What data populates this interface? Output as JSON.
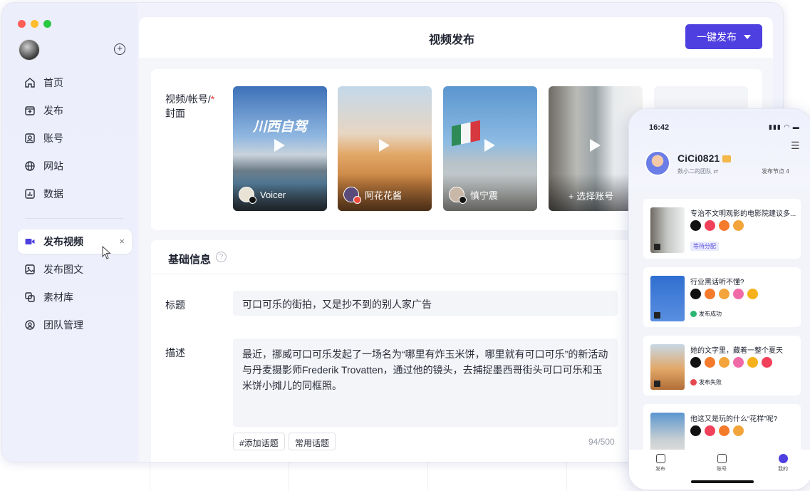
{
  "sidebar": {
    "items": [
      {
        "label": "首页",
        "icon": "home-icon"
      },
      {
        "label": "发布",
        "icon": "publish-icon"
      },
      {
        "label": "账号",
        "icon": "account-icon"
      },
      {
        "label": "网站",
        "icon": "globe-icon"
      },
      {
        "label": "数据",
        "icon": "chart-icon"
      }
    ],
    "open_items": [
      {
        "label": "发布视频",
        "icon": "video-icon",
        "active": true
      },
      {
        "label": "发布图文",
        "icon": "image-icon"
      },
      {
        "label": "素材库",
        "icon": "library-icon"
      },
      {
        "label": "团队管理",
        "icon": "team-icon"
      }
    ],
    "close_glyph": "×"
  },
  "header": {
    "title": "视频发布",
    "publish_label": "一键发布"
  },
  "cover": {
    "label": "视频/帐号/",
    "label2": "封面",
    "required_mark": "*",
    "videos": [
      {
        "account": "Voicer",
        "overlay_text": "川西自驾"
      },
      {
        "account": "阿花花酱"
      },
      {
        "account": "慎宁震"
      },
      {
        "account": "+ 选择账号"
      }
    ]
  },
  "basic": {
    "section_title": "基础信息",
    "help_glyph": "?",
    "title_label": "标题",
    "title_value": "可口可乐的街拍，又是抄不到的别人家广告",
    "desc_label": "描述",
    "desc_value": "最近，挪威可口可乐发起了一场名为“哪里有炸玉米饼，哪里就有可口可乐”的新活动与丹麦摄影师Frederik Trovatten，通过他的镜头，去捕捉墨西哥街头可口可乐和玉米饼小摊儿的同框照。",
    "tags": [
      "#添加话题",
      "常用话题"
    ],
    "counter": "94/500"
  },
  "phone": {
    "time": "16:42",
    "status_icons": "▮▮▮ ◠ ▬",
    "menu_glyph": "☰",
    "user_name": "CiCi0821",
    "team": "数小二的团队 ⇄",
    "node": "发布节点 4",
    "items": [
      {
        "title": "专治不文明观影的电影院建议多...",
        "status": "等待分配",
        "status_type": "wait"
      },
      {
        "title": "行业黑话听不懂?",
        "status": "发布成功",
        "status_type": "ok"
      },
      {
        "title": "她的文字里，藏着一整个夏天",
        "status": "发布失败",
        "status_type": "fail"
      },
      {
        "title": "他这又是玩的什么“花样”呢?",
        "status": "",
        "status_type": "none"
      }
    ],
    "tabs": [
      "发布",
      "账号",
      "我的"
    ]
  },
  "colors": {
    "accent": "#4e3fe0",
    "traffic_red": "#ff5f57",
    "traffic_yellow": "#febc2e",
    "traffic_green": "#28c840"
  }
}
